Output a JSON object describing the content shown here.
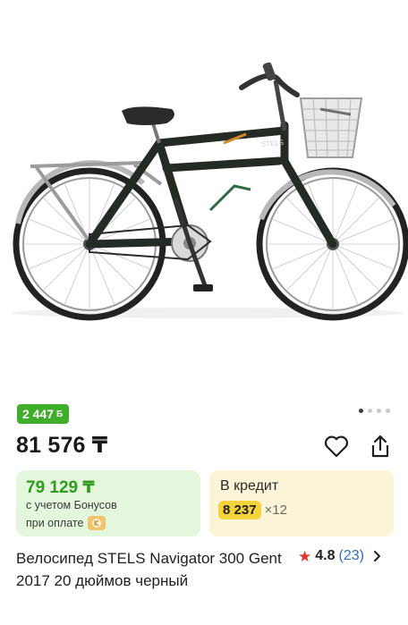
{
  "product": {
    "bonus_badge": "2 447",
    "bonus_badge_icon": "Б",
    "price": "81 576 ₸",
    "title": "Велосипед STELS Navigator 300 Gent 2017 20 дюймов черный",
    "rating_value": "4.8",
    "rating_count": "(23)"
  },
  "bonus_card": {
    "price": "79 129 ₸",
    "note_line1": "с учетом Бонусов",
    "note_line2": "при оплате"
  },
  "credit_card": {
    "label": "В кредит",
    "monthly": "8 237",
    "multiplier": "×12"
  },
  "gallery": {
    "total": 4,
    "active": 1
  },
  "icons": {
    "favorite": "heart-icon",
    "share": "share-icon",
    "rating": "star-icon",
    "more": "chevron-right-icon",
    "payment": "kaspi-pay-icon"
  },
  "colors": {
    "bonus_green": "#3fae2a",
    "bonus_card_bg": "#e4f6dc",
    "credit_card_bg": "#fbf4d6",
    "credit_highlight": "#f5d33a",
    "star_red": "#e2342a",
    "link_blue": "#2f6ec7"
  }
}
